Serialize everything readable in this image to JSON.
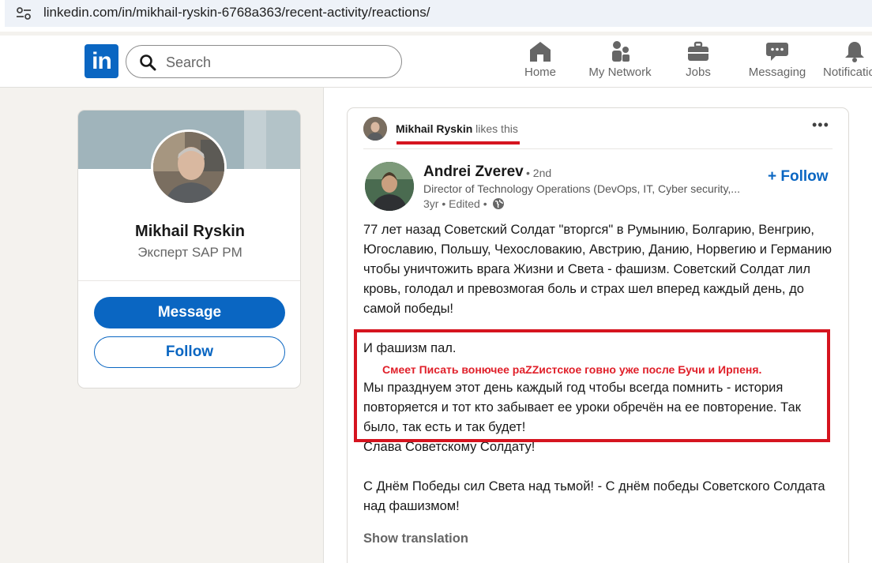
{
  "browser": {
    "url": "linkedin.com/in/mikhail-ryskin-6768a363/recent-activity/reactions/"
  },
  "nav": {
    "logo": "in",
    "search_placeholder": "Search",
    "items": [
      {
        "label": "Home",
        "icon": "home-icon"
      },
      {
        "label": "My Network",
        "icon": "people-icon"
      },
      {
        "label": "Jobs",
        "icon": "briefcase-icon"
      },
      {
        "label": "Messaging",
        "icon": "chat-icon"
      },
      {
        "label": "Notifications",
        "icon": "bell-icon"
      }
    ],
    "colors": {
      "brand": "#0a66c2",
      "icon": "#666666"
    }
  },
  "profile": {
    "name": "Mikhail Ryskin",
    "title": "Эксперт SAP PM",
    "message_label": "Message",
    "follow_label": "Follow"
  },
  "post": {
    "activity_actor": "Mikhail Ryskin",
    "activity_text": "likes this",
    "author": {
      "name": "Andrei Zverev",
      "degree": "• 2nd",
      "headline": "Director of Technology Operations (DevOps, IT, Cyber security,...",
      "meta": "3yr • Edited •",
      "follow_label": "+ Follow"
    },
    "paragraphs": [
      "77 лет назад Советский Солдат \"вторгся\" в Румынию, Болгарию, Венгрию, Югославию, Польшу, Чехословакию, Австрию, Данию, Норвегию и Германию чтобы уничтожить врага Жизни и Света - фашизм. Советский Солдат лил кровь, голодал и превозмогая боль и страх шел вперед каждый день, до самой победы!",
      "И фашизм пал.",
      "Мы празднуем этот день каждый год чтобы всегда помнить - история повторяется и тот кто забывает ее уроки обречён на ее повторение. Так было, так есть и так будет!",
      "Слава Советскому Солдату!",
      "С Днём Победы сил Света над тьмой! - С днём победы Советского Солдата над фашизмом!"
    ],
    "annotation": "Смеет Писать вонючее раZZистское говно уже после Бучи и Ирпеня.",
    "show_translation": "Show translation",
    "colors": {
      "annotation_red": "#d5141f"
    }
  }
}
